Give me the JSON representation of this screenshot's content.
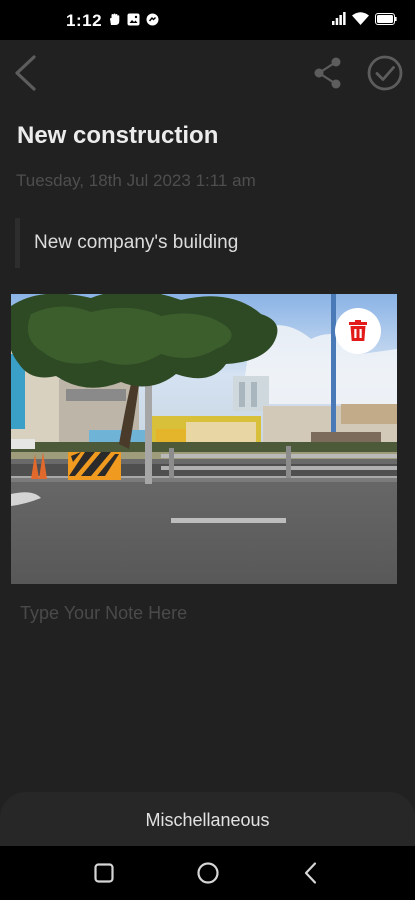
{
  "status_bar": {
    "time": "1:12",
    "notification_icons": [
      "hand-icon",
      "image-icon",
      "chat-bubble-icon"
    ],
    "system_icons": [
      "signal-icon",
      "wifi-icon",
      "battery-icon"
    ]
  },
  "toolbar": {
    "back_icon": "chevron-left-icon",
    "share_icon": "share-icon",
    "save_icon": "check-circle-icon"
  },
  "note": {
    "title": "New construction",
    "date": "Tuesday, 18th Jul 2023 1:11 am",
    "subtitle": "New company's building",
    "body_value": "",
    "body_placeholder": "Type Your Note Here"
  },
  "photo": {
    "description_icon": "street-photo",
    "delete_icon": "trash-icon",
    "delete_color": "#e21a1a"
  },
  "category": {
    "label": "Mischellaneous"
  },
  "nav_bar": {
    "items": [
      "recents-icon",
      "home-icon",
      "back-icon"
    ]
  },
  "colors": {
    "background": "#212121",
    "status_bar": "#000000",
    "title_text": "#ececec",
    "muted_text": "#4e4e4e"
  }
}
